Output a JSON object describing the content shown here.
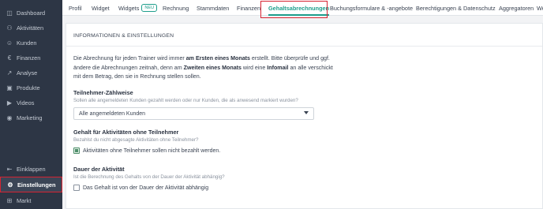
{
  "sidebar": {
    "items": [
      {
        "label": "Dashboard",
        "icon": "dashboard-icon",
        "glyph": "◫"
      },
      {
        "label": "Aktivitäten",
        "icon": "activities-icon",
        "glyph": "⚇"
      },
      {
        "label": "Kunden",
        "icon": "customers-icon",
        "glyph": "☺"
      },
      {
        "label": "Finanzen",
        "icon": "euro-icon",
        "glyph": "€"
      },
      {
        "label": "Analyse",
        "icon": "analytics-icon",
        "glyph": "↗"
      },
      {
        "label": "Produkte",
        "icon": "products-icon",
        "glyph": "▣"
      },
      {
        "label": "Videos",
        "icon": "video-icon",
        "glyph": "▶"
      },
      {
        "label": "Marketing",
        "icon": "marketing-icon",
        "glyph": "◉"
      }
    ],
    "bottom": [
      {
        "label": "Einklappen",
        "icon": "collapse-icon",
        "glyph": "⇤"
      },
      {
        "label": "Einstellungen",
        "icon": "gear-icon",
        "glyph": "⚙"
      },
      {
        "label": "Markt",
        "icon": "market-icon",
        "glyph": "⊞"
      }
    ]
  },
  "tabs": [
    {
      "label": "Profil"
    },
    {
      "label": "Widget"
    },
    {
      "label": "Widgets",
      "badge": "NEU"
    },
    {
      "label": "Rechnung"
    },
    {
      "label": "Stammdaten"
    },
    {
      "label": "Finanzen"
    },
    {
      "label": "Gehaltsabrechnungen"
    },
    {
      "label": "Buchungsformulare & -angebote"
    },
    {
      "label": "Berechtigungen & Datenschutz"
    },
    {
      "label": "Aggregatoren"
    },
    {
      "label": "We"
    }
  ],
  "content": {
    "section_title": "INFORMATIONEN & EINSTELLUNGEN",
    "info": {
      "p1": "Die Abrechnung für jeden Trainer wird immer ",
      "b1": "am Ersten eines Monats",
      "p2": " erstellt. Bitte überprüfe und ggf. ändere die Abrechnungen zeitnah, denn am ",
      "b2": "Zweiten eines Monats",
      "p3": " wird eine ",
      "b3": "Infomail",
      "p4": " an alle verschickt mit dem Betrag, den sie in Rechnung stellen sollen."
    },
    "counting": {
      "label": "Teilnehmer-Zählweise",
      "hint": "Sollen alle angemeldeten Kunden gezahlt werden oder nur Kunden, die als anwesend markiert wurden?",
      "selected": "Alle angemeldeten Kunden"
    },
    "no_participants": {
      "label": "Gehalt für Aktivitäten ohne Teilnehmer",
      "hint": "Bezahlst du nicht abgesagte Aktivitäten ohne Teilnehmer?",
      "checkbox_label": "Aktivitäten ohne Teilnehmer sollen nicht bezahlt werden.",
      "checked": true
    },
    "duration": {
      "label": "Dauer der Aktivität",
      "hint": "Ist die Berechnung des Gehalts von der Dauer der Aktivität abhängig?",
      "checkbox_label": "Das Gehalt ist von der Dauer der Aktivität abhängig",
      "checked": false
    }
  },
  "colors": {
    "sidebar_bg": "#2d3645",
    "accent": "#1e9e8c",
    "highlight": "#d62432"
  }
}
